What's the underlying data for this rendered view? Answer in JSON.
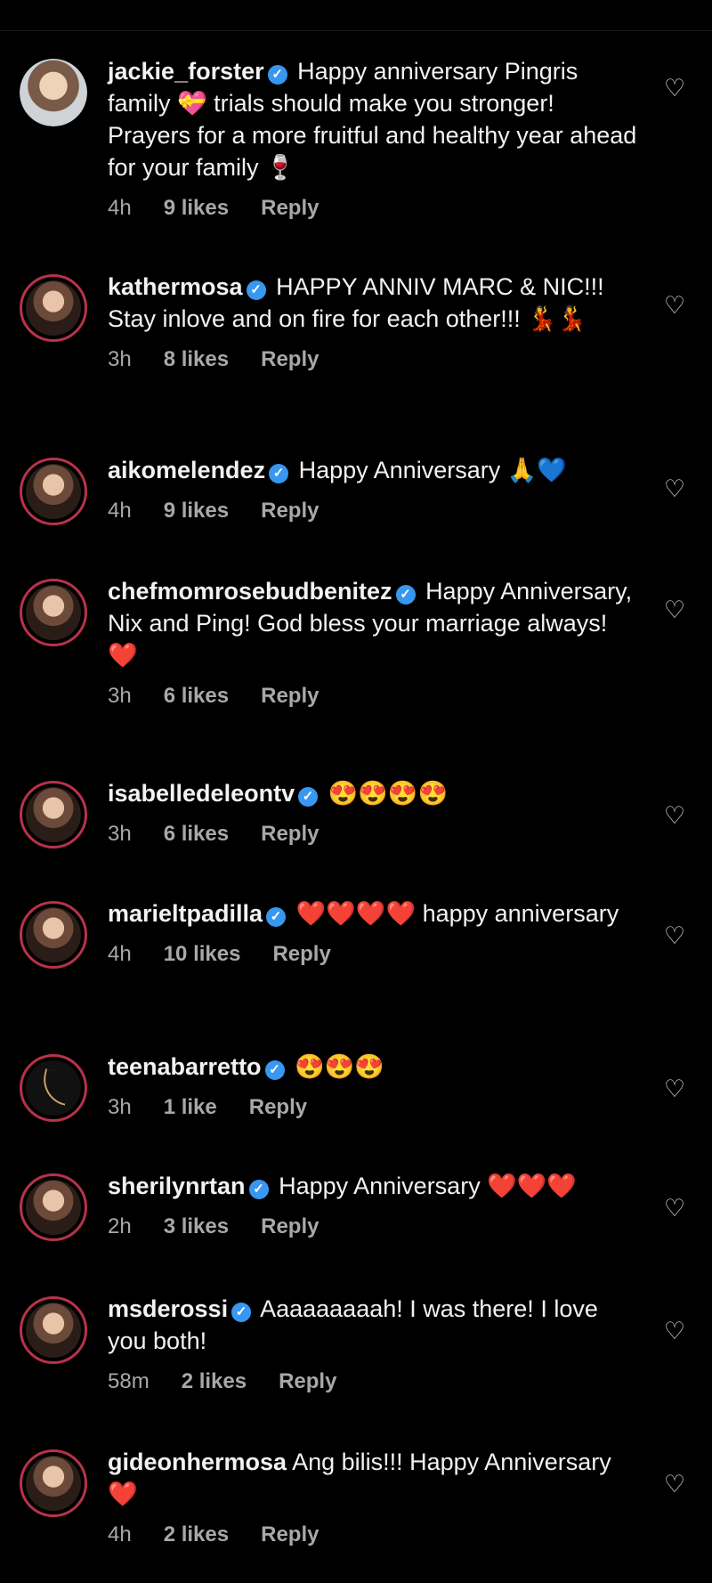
{
  "comments": [
    {
      "username": "jackie_forster",
      "text": "Happy anniversary Pingris family 💝  trials should make you stronger! Prayers for a more fruitful and healthy year ahead for your family 🍷",
      "time": "4h",
      "likes": "9 likes",
      "reply": "Reply"
    },
    {
      "username": "kathermosa",
      "text": "HAPPY ANNIV MARC & NIC!!! Stay inlove and on fire for each other!!! 💃💃",
      "time": "3h",
      "likes": "8 likes",
      "reply": "Reply"
    },
    {
      "username": "aikomelendez",
      "text": "Happy Anniversary 🙏💙",
      "time": "4h",
      "likes": "9 likes",
      "reply": "Reply"
    },
    {
      "username": "chefmomrosebudbenitez",
      "text": "Happy Anniversary, Nix and Ping! God bless your marriage always! ❤️",
      "time": "3h",
      "likes": "6 likes",
      "reply": "Reply"
    },
    {
      "username": "isabelledeleontv",
      "text": "😍😍😍😍",
      "time": "3h",
      "likes": "6 likes",
      "reply": "Reply"
    },
    {
      "username": "marieltpadilla",
      "text": "❤️❤️❤️❤️ happy anniversary",
      "time": "4h",
      "likes": "10 likes",
      "reply": "Reply"
    },
    {
      "username": "teenabarretto",
      "text": "😍😍😍",
      "time": "3h",
      "likes": "1 like",
      "reply": "Reply"
    },
    {
      "username": "sherilynrtan",
      "text": "Happy Anniversary ❤️❤️❤️",
      "time": "2h",
      "likes": "3 likes",
      "reply": "Reply"
    },
    {
      "username": "msderossi",
      "text": "Aaaaaaaaah! I was there! I love you both!",
      "time": "58m",
      "likes": "2 likes",
      "reply": "Reply"
    },
    {
      "username": "gideonhermosa",
      "text": "Ang bilis!!! Happy Anniversary ❤️",
      "time": "4h",
      "likes": "2 likes",
      "reply": "Reply"
    }
  ],
  "icons": {
    "verified": "verified-badge-icon",
    "like": "heart-outline-icon"
  },
  "colors": {
    "background": "#000000",
    "text": "#f2f2f2",
    "meta": "#a8a8a8",
    "verified": "#3897f0",
    "story_ring": "#b8324a"
  }
}
